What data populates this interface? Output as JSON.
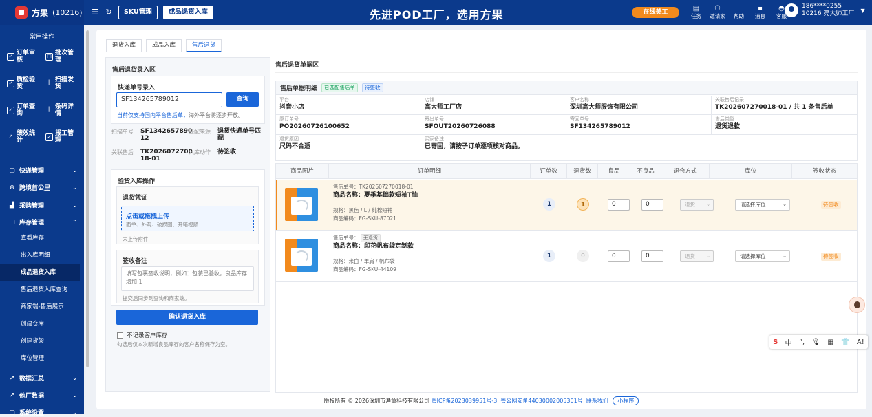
{
  "brand": {
    "name": "方果",
    "count": "(10216)"
  },
  "topbar": {
    "sku_tab": "SKU管理",
    "return_tab": "成品退货入库",
    "slogan": "先进POD工厂，选用方果",
    "online": "在线美工",
    "icons": [
      {
        "icon": "task-icon",
        "label": "任务"
      },
      {
        "icon": "invite-icon",
        "label": "邀请家"
      },
      {
        "icon": "help-icon",
        "label": "帮助"
      },
      {
        "icon": "message-icon",
        "label": "消息"
      },
      {
        "icon": "service-icon",
        "label": "客服"
      }
    ],
    "user_phone": "186****0255",
    "user_name": "10216 亮大师工厂"
  },
  "sidebar": {
    "common_title": "常用操作",
    "grid": [
      {
        "label": "订单审核",
        "icon": "check-icon"
      },
      {
        "label": "批次管理",
        "icon": "batch-icon"
      },
      {
        "label": "质检验货",
        "icon": "check-icon"
      },
      {
        "label": "扫描发货",
        "icon": "barcode-icon"
      },
      {
        "label": "订单查询",
        "icon": "check-icon"
      },
      {
        "label": "条码详情",
        "icon": "barcode-icon"
      },
      {
        "label": "绩效统计",
        "icon": "chart-icon"
      },
      {
        "label": "报工管理",
        "icon": "check-icon"
      }
    ],
    "menus": [
      {
        "label": "快递管理",
        "icon": "box-icon"
      },
      {
        "label": "跨境首公里",
        "icon": "globe-icon"
      },
      {
        "label": "采购管理",
        "icon": "cart-icon"
      },
      {
        "label": "库存管理",
        "icon": "box-icon"
      }
    ],
    "sub": [
      "查看库存",
      "出入库明细",
      "成品退货入库",
      "售后退货入库查询",
      "商家端-售后展示",
      "创建仓库",
      "创建货架",
      "库位管理"
    ],
    "bottom": [
      {
        "label": "数据汇总",
        "icon": "chart-icon"
      },
      {
        "label": "他厂数据",
        "icon": "chart-icon"
      },
      {
        "label": "系统设置",
        "icon": "box-icon"
      }
    ]
  },
  "tabs": [
    "退货入库",
    "成品入库",
    "售后退货"
  ],
  "left": {
    "title": "售后退货录入区",
    "express_title": "快递单号录入",
    "express_value": "SF134265789012",
    "query": "查询",
    "tip_blue": "当前仅支持国内平台售后单，",
    "tip_grey": "海外平台将逐步开放。",
    "scan_k": "扫描单号",
    "scan_v": "SF1342657890 12",
    "match_k": "匹配来源",
    "match_v": "退货快递单号匹配",
    "after_k": "关联售后",
    "after_v": "TK2026072700 18-01",
    "action_k": "入库动作",
    "action_v": "待签收",
    "verify_title": "验货入库操作",
    "proof_title": "退货凭证",
    "upload_main": "点击或拖拽上传",
    "upload_sub": "面单、外观、破损图、开箱视频",
    "no_attach": "未上传附件",
    "remark_title": "签收备注",
    "remark_ph": "填写包裹签收说明，例如：包装已验收，良品库存增加 1",
    "remark_tip": "提交后同步到查询和商家端。",
    "confirm": "确认退货入库",
    "checkbox": "不记录客户库存",
    "checkbox_tip": "勾选后仅本次新增良品库存的客户名称保存为空。"
  },
  "right": {
    "title": "售后退货单据区",
    "detail_title": "售后单据明细",
    "tag1": "已匹配售后单",
    "tag2": "待签收",
    "cells": [
      {
        "k": "平台",
        "v": "抖音小店"
      },
      {
        "k": "店铺",
        "v": "高大师工厂店"
      },
      {
        "k": "客户名称",
        "v": "深圳高大师服饰有限公司"
      },
      {
        "k": "关联售后记录",
        "v": "TK202607270018-01 / 共 1 条售后单"
      },
      {
        "k": "原订单号",
        "v": "PO20260726100652"
      },
      {
        "k": "寄出单号",
        "v": "SFOUT20260726088"
      },
      {
        "k": "寄回单号",
        "v": "SF134265789012"
      },
      {
        "k": "售后类型",
        "v": "退货退款"
      },
      {
        "k": "退货原因",
        "v": "尺码不合适"
      },
      {
        "k": "买家备注",
        "v": "已寄回，请按子订单逐项核对商品。"
      }
    ],
    "headers": [
      "商品图片",
      "订单明细",
      "订单数",
      "退货数",
      "良品",
      "不良品",
      "退仓方式",
      "库位",
      "签收状态"
    ],
    "rows": [
      {
        "after_no": "售后单号：TK202607270018-01",
        "name": "商品名称：夏季基础款短袖T恤",
        "spec": "规格：黑色 / L / 纯棉短袖",
        "code": "商品编码：FG-SKU-87021",
        "orders": "1",
        "returns": "1",
        "good": "0",
        "bad": "0",
        "method": "退货",
        "loc": "请选择库位",
        "status": "待签收"
      },
      {
        "after_no_k": "售后单号：",
        "after_chip": "无退货",
        "name": "商品名称：印花帆布袋定制款",
        "spec": "规格：米白 / 单肩 / 帆布袋",
        "code": "商品编码：FG-SKU-44109",
        "orders": "1",
        "returns": "0",
        "good": "0",
        "bad": "0",
        "method": "退货",
        "loc": "请选择库位",
        "status": "待签收"
      }
    ]
  },
  "footer": {
    "copy": "版权所有 © 2026深圳市渔童科技有限公司",
    "icp": "粤ICP备2023039951号-3",
    "police": "粤公网安备44030002005301号",
    "contact": "联系我们",
    "mini": "小程序"
  },
  "ime": [
    "S",
    "中",
    "°,",
    "🎙",
    "▦",
    "👕",
    "A!"
  ]
}
